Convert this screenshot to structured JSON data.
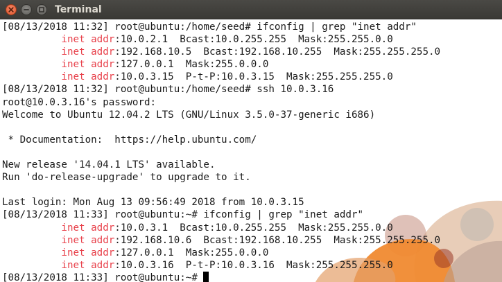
{
  "window": {
    "title": "Terminal"
  },
  "terminal": {
    "indent": "          ",
    "highlight_color": "#e8404a",
    "lines": [
      {
        "id": "cmd1",
        "text": "[08/13/2018 11:32] root@ubuntu:/home/seed# ifconfig | grep \"inet addr\""
      },
      {
        "id": "inet-eth0",
        "kw": "inet addr",
        "rest": ":10.0.2.1  Bcast:10.0.255.255  Mask:255.255.0.0"
      },
      {
        "id": "inet-eth1",
        "kw": "inet addr",
        "rest": ":192.168.10.5  Bcast:192.168.10.255  Mask:255.255.255.0"
      },
      {
        "id": "inet-lo",
        "kw": "inet addr",
        "rest": ":127.0.0.1  Mask:255.0.0.0"
      },
      {
        "id": "inet-tun",
        "kw": "inet addr",
        "rest": ":10.0.3.15  P-t-P:10.0.3.15  Mask:255.255.255.0"
      },
      {
        "id": "cmd2",
        "text": "[08/13/2018 11:32] root@ubuntu:/home/seed# ssh 10.0.3.16"
      },
      {
        "id": "password-prompt",
        "text": "root@10.0.3.16's password:"
      },
      {
        "id": "welcome",
        "text": "Welcome to Ubuntu 12.04.2 LTS (GNU/Linux 3.5.0-37-generic i686)"
      },
      {
        "id": "blank1",
        "text": ""
      },
      {
        "id": "documentation",
        "text": " * Documentation:  https://help.ubuntu.com/"
      },
      {
        "id": "blank2",
        "text": ""
      },
      {
        "id": "release",
        "text": "New release '14.04.1 LTS' available."
      },
      {
        "id": "upgrade",
        "text": "Run 'do-release-upgrade' to upgrade to it."
      },
      {
        "id": "blank3",
        "text": ""
      },
      {
        "id": "last-login",
        "text": "Last login: Mon Aug 13 09:56:49 2018 from 10.0.3.15"
      },
      {
        "id": "cmd3",
        "text": "[08/13/2018 11:33] root@ubuntu:~# ifconfig | grep \"inet addr\""
      },
      {
        "id": "remote-inet-eth0",
        "kw": "inet addr",
        "rest": ":10.0.3.1  Bcast:10.0.255.255  Mask:255.255.0.0"
      },
      {
        "id": "remote-inet-eth1",
        "kw": "inet addr",
        "rest": ":192.168.10.6  Bcast:192.168.10.255  Mask:255.255.255.0"
      },
      {
        "id": "remote-inet-lo",
        "kw": "inet addr",
        "rest": ":127.0.0.1  Mask:255.0.0.0"
      },
      {
        "id": "remote-inet-tun",
        "kw": "inet addr",
        "rest": ":10.0.3.16  P-t-P:10.0.3.16  Mask:255.255.255.0"
      }
    ],
    "prompt": "[08/13/2018 11:33] root@ubuntu:~# "
  }
}
